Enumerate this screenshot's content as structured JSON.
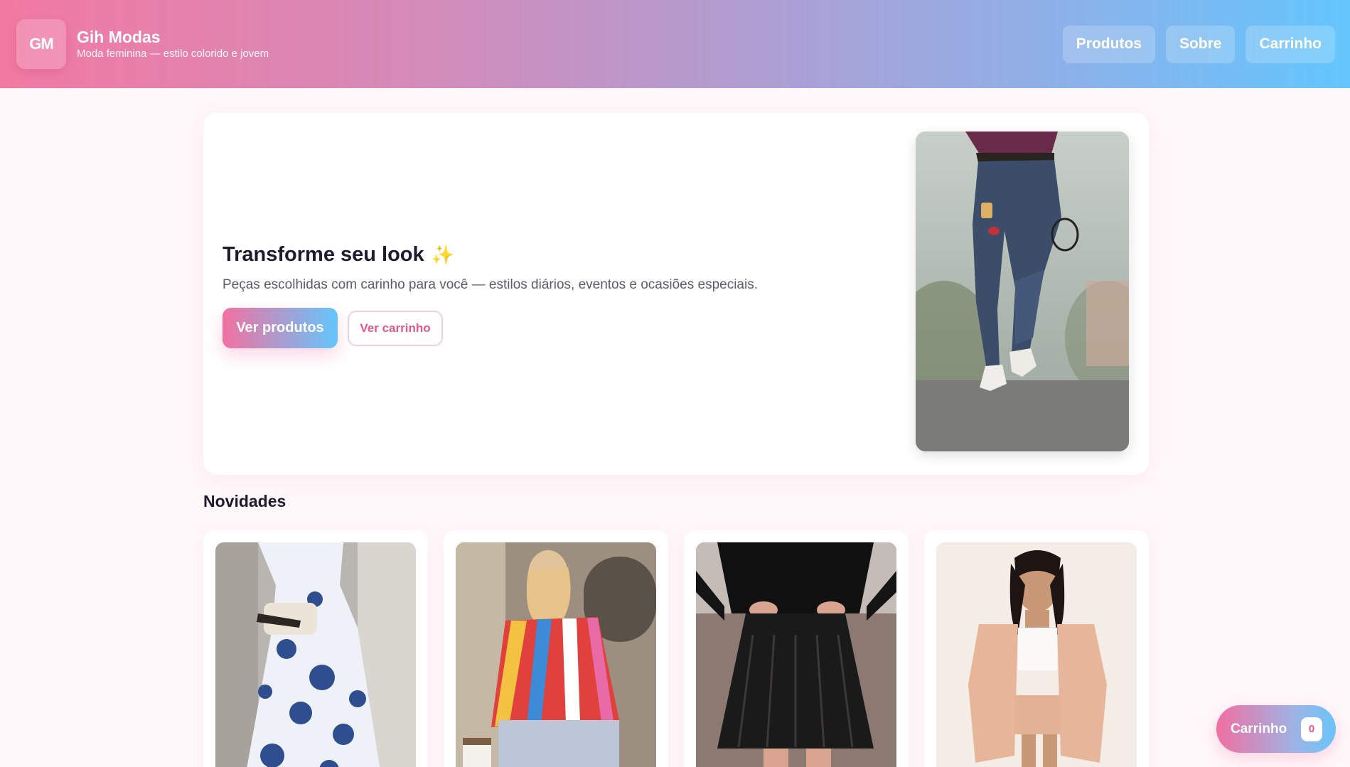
{
  "header": {
    "logo_text": "GM",
    "brand_name": "Gih Modas",
    "brand_tagline": "Moda feminina — estilo colorido e jovem",
    "nav": [
      {
        "label": "Produtos"
      },
      {
        "label": "Sobre"
      },
      {
        "label": "Carrinho"
      }
    ]
  },
  "hero": {
    "title": "Transforme seu look",
    "title_icon": "sparkles-icon",
    "subtitle": "Peças escolhidas com carinho para você — estilos diários, eventos e ocasiões especiais.",
    "primary_button": "Ver produtos",
    "secondary_button": "Ver carrinho",
    "image": "model-jeans-sneakers-photo"
  },
  "section": {
    "title": "Novidades",
    "products": [
      {
        "image": "floral-maxi-dress-photo"
      },
      {
        "image": "striped-colorful-blouse-photo"
      },
      {
        "image": "black-pleated-leather-skirt-photo"
      },
      {
        "image": "peach-linen-set-photo"
      }
    ]
  },
  "floating_cart": {
    "label": "Carrinho",
    "count": "0"
  },
  "colors": {
    "gradient_start": "#f27aa2",
    "gradient_end": "#63c6fd",
    "accent_pink": "#e2588c",
    "page_background": "#fff8fa"
  }
}
